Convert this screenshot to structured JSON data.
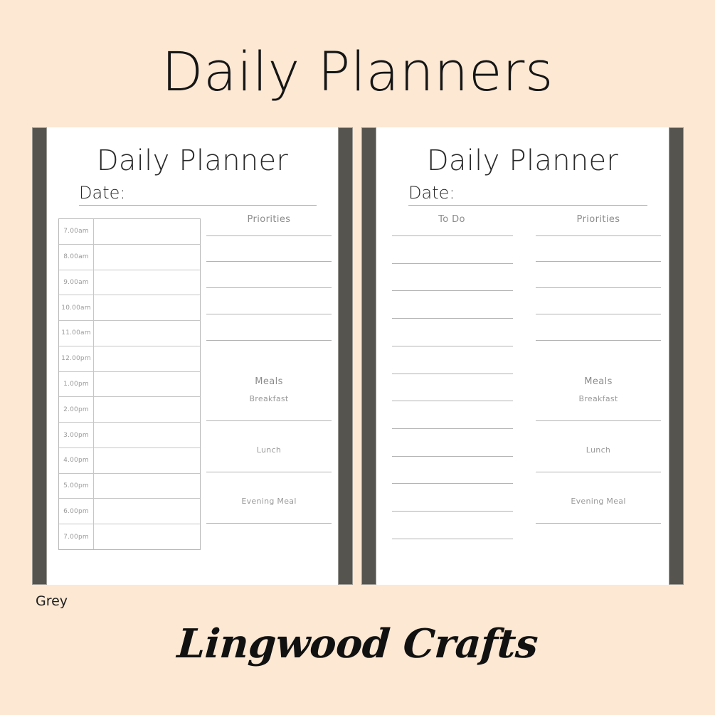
{
  "header": {
    "title": "Daily Planners"
  },
  "colors": {
    "background": "#fce8d3",
    "page": "#ffffff",
    "spine": "#56544e",
    "rule": "#b3b3b3",
    "heading_text": "#8b8b8b",
    "title_text": "#151515"
  },
  "footer": {
    "color_label": "Grey",
    "brand": "Lingwood Crafts"
  },
  "left_page": {
    "title": "Daily Planner",
    "date_label": "Date:",
    "schedule": {
      "times": [
        "7.00am",
        "8.00am",
        "9.00am",
        "10.00am",
        "11.00am",
        "12.00pm",
        "1.00pm",
        "2.00pm",
        "3.00pm",
        "4.00pm",
        "5.00pm",
        "6.00pm",
        "7.00pm"
      ]
    },
    "priorities": {
      "heading": "Priorities",
      "line_count": 5
    },
    "meals": {
      "heading": "Meals",
      "items": [
        "Breakfast",
        "Lunch",
        "Evening Meal"
      ]
    }
  },
  "right_page": {
    "title": "Daily Planner",
    "date_label": "Date:",
    "todo": {
      "heading": "To Do",
      "line_count": 12
    },
    "priorities": {
      "heading": "Priorities",
      "line_count": 5
    },
    "meals": {
      "heading": "Meals",
      "items": [
        "Breakfast",
        "Lunch",
        "Evening Meal"
      ]
    }
  }
}
